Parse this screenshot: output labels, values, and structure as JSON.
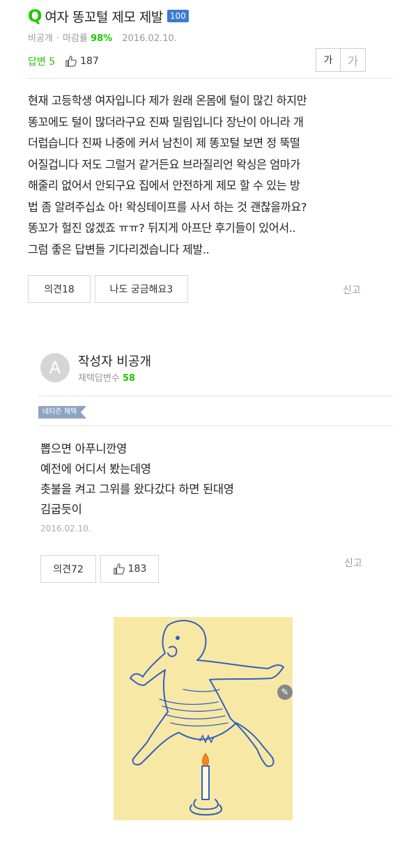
{
  "question": {
    "icon": "Q",
    "title": "여자 똥꼬털 제모 제발",
    "points": "100",
    "author": "비공개",
    "deadline_label": "마감률",
    "deadline_rate": "98%",
    "date": "2016.02.10.",
    "answers_label": "답변 5",
    "likes": "187",
    "font_small": "가",
    "font_large": "가",
    "body_lines": [
      "현재 고등학생 여자입니다 제가 원래 온몸에 털이 많긴 하지만",
      "똥꼬에도 털이 많더라구요 진짜 밀림입니다 장난이 아니라 개",
      "더럽습니다 진짜 나중에 커서 남친이 제 똥꼬털 보면 정 뚝떨",
      "어질겁니다 저도 그럴거 같거든요 브라질리언 왁싱은 엄마가",
      "해줄리 없어서 안되구요 집에서 안전하게 제모 할 수 있는 방",
      "법 좀 알려주십쇼 아! 왁싱테이프를 사서 하는 것 괜찮을까요?",
      "똥꼬가 헐진 않겠죠 ㅠㅠ? 뒤지게 아프단 후기들이 있어서..",
      "그럼 좋은 답변들 기다리겠습니다 제발.."
    ],
    "comment_btn": "의견18",
    "curious_btn": "나도 궁금해요3",
    "report": "신고"
  },
  "answer": {
    "avatar_letter": "A",
    "name": "작성자 비공개",
    "selected_label": "채택답변수",
    "selected_count": "58",
    "tag": "네티즌 채택",
    "body_lines": [
      "뽑으면 아푸니깐영",
      "예전에 어디서 봤는데영",
      "촛불을 켜고 그위를 왔다갔다 하면 된대영",
      "김굽듯이"
    ],
    "date": "2016.02.10.",
    "comment_btn": "의견72",
    "likes": "183",
    "report": "신고"
  },
  "colors": {
    "accent_green": "#1ec800",
    "points_blue": "#3a7bd5",
    "tag_blue": "#8da4c4",
    "drawing_bg": "#f8e8a6",
    "drawing_stroke": "#2f5fbf"
  },
  "icons": [
    "question-q-icon",
    "thumbs-up-icon",
    "pencil-edit-icon"
  ]
}
